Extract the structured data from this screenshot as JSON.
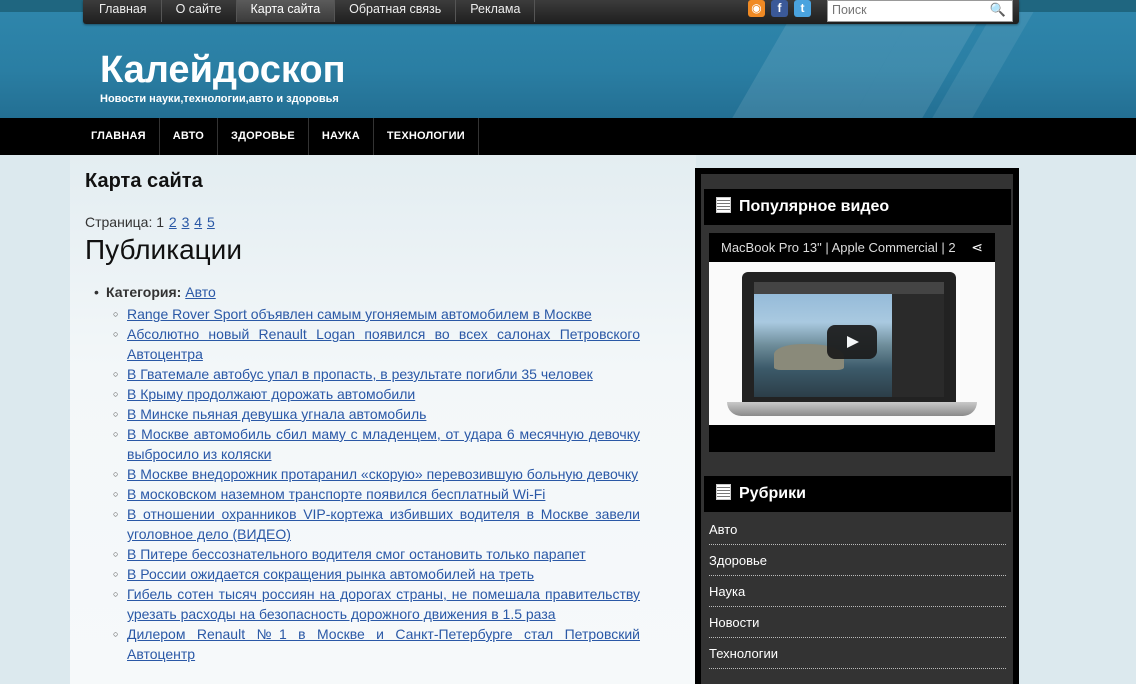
{
  "topnav": {
    "items": [
      {
        "label": "Главная",
        "active": false
      },
      {
        "label": "О сайте",
        "active": false
      },
      {
        "label": "Карта сайта",
        "active": true
      },
      {
        "label": "Обратная связь",
        "active": false
      },
      {
        "label": "Реклама",
        "active": false
      }
    ],
    "social_icons": [
      "rss-icon",
      "facebook-icon",
      "twitter-icon"
    ]
  },
  "search": {
    "placeholder": "Поиск"
  },
  "site": {
    "title": "Калейдоскоп",
    "subtitle": "Новости науки,технологии,авто и здоровья"
  },
  "catnav": {
    "items": [
      "ГЛАВНАЯ",
      "АВТО",
      "ЗДОРОВЬЕ",
      "НАУКА",
      "ТЕХНОЛОГИИ"
    ]
  },
  "main": {
    "title": "Карта сайта",
    "pages_label": "Страница:",
    "pages": [
      "1",
      "2",
      "3",
      "4",
      "5"
    ],
    "current_page": "1",
    "publications_heading": "Публикации",
    "category_label": "Категория:",
    "category_name": "Авто",
    "posts": [
      "Range Rover Sport объявлен самым угоняемым автомобилем в Москве",
      "Абсолютно новый Renault Logan появился во всех салонах Петровского Автоцентра",
      "В Гватемале автобус упал в пропасть, в результате погибли 35 человек",
      "В Крыму продолжают дорожать автомобили",
      "В Минске пьяная девушка угнала автомобиль",
      "В Москве автомобиль сбил маму с младенцем, от удара 6 месячную девочку выбросило из коляски",
      "В Москве внедорожник протаранил «скорую» перевозившую больную девочку",
      "В московском наземном транспорте появился бесплатный Wi-Fi",
      "В отношении охранников VIP-кортежа избивших водителя в Москве завели уголовное дело (ВИДЕО)",
      "В Питере бессознательного водителя смог остановить только парапет",
      "В России ожидается сокращения рынка автомобилей на треть",
      "Гибель сотен тысяч россиян на дорогах страны, не помешала правительству урезать расходы на безопасность дорожного движения в 1.5 раза",
      "Дилером Renault №1 в Москве и Санкт-Петербурге стал Петровский Автоцентр"
    ]
  },
  "sidebar": {
    "video_widget_title": "Популярное видео",
    "video_title": "MacBook Pro 13\" | Apple Commercial | 2",
    "rubrics_title": "Рубрики",
    "rubrics": [
      "Авто",
      "Здоровье",
      "Наука",
      "Новости",
      "Технологии"
    ]
  },
  "colors": {
    "header_blue": "#2a7ea3",
    "link": "#2a58a6",
    "nav_black": "#000000",
    "sidebar_gray": "#333333"
  }
}
